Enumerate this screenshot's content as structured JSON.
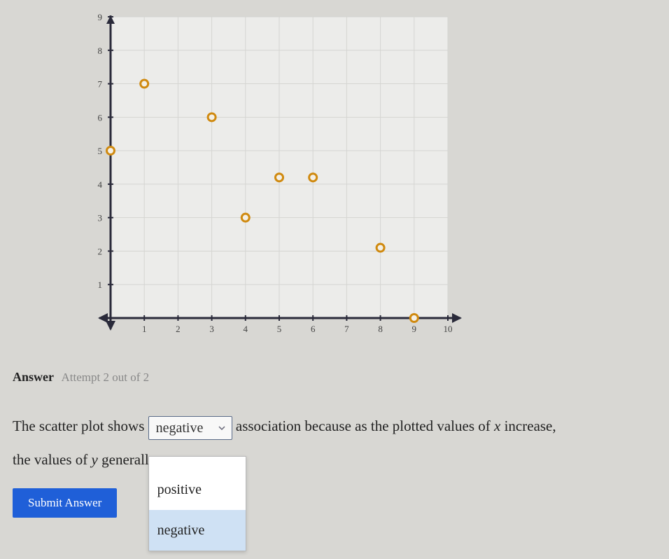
{
  "chart_data": {
    "type": "scatter",
    "x": [
      0,
      1,
      3,
      4,
      5,
      6,
      8,
      9
    ],
    "y": [
      5,
      7,
      6,
      3,
      4.2,
      4.2,
      2.1,
      0
    ],
    "xlabel": "",
    "ylabel": "",
    "xlim": [
      0,
      10
    ],
    "ylim": [
      0,
      9
    ],
    "xticks": [
      1,
      2,
      3,
      4,
      5,
      6,
      7,
      8,
      9,
      10
    ],
    "yticks": [
      1,
      2,
      3,
      4,
      5,
      6,
      7,
      8,
      9
    ],
    "point_color": "#d08a10",
    "grid": true
  },
  "answer": {
    "label": "Answer",
    "attempt_text": "Attempt 2 out of 2"
  },
  "sentence": {
    "part1": "The scatter plot shows ",
    "select1_value": "negative",
    "part2": " association because as the plotted values of ",
    "var1": "x",
    "part3": " increase,",
    "line2a": "the values of ",
    "var2": "y",
    "line2b": " generall",
    "period": " ."
  },
  "dropdown": {
    "options": [
      "",
      "positive",
      "negative"
    ],
    "selected": "negative"
  },
  "submit": {
    "label": "Submit Answer"
  }
}
